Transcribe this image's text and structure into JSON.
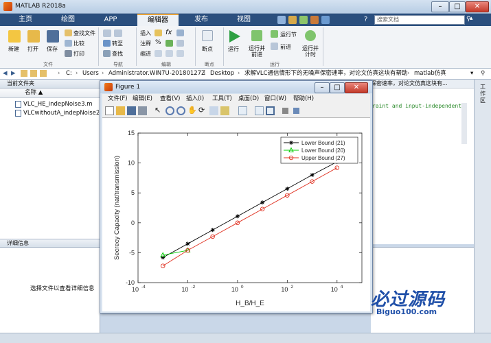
{
  "window": {
    "title": "MATLAB R2018a"
  },
  "tabs": [
    "主页",
    "绘图",
    "APP",
    "编辑器",
    "发布",
    "视图"
  ],
  "search": {
    "placeholder": "搜索文档"
  },
  "ribbon": {
    "new": "新建",
    "open": "打开",
    "save": "保存",
    "find_files": "查找文件",
    "compare": "比较",
    "print": "打印",
    "goto": "转至",
    "find": "查找",
    "insert": "插入",
    "comment": "注释",
    "indent": "缩进",
    "breakpoints": "断点",
    "run": "运行",
    "run_advance": "运行并\n前进",
    "run_section": "运行节",
    "advance": "前进",
    "run_time": "运行并\n计时",
    "groups": {
      "file": "文件",
      "navigate": "导航",
      "edit": "编辑",
      "breakpoints": "断点",
      "run": "运行"
    }
  },
  "address": {
    "parts": [
      "C:",
      "Users",
      "Administrator.WIN7U-20180127Z",
      "Desktop",
      "求解VLC通信情形下的无噪声保密速率，对论文仿真这块有帮助",
      "matlab仿真"
    ]
  },
  "current_folder": {
    "title": "当前文件夹",
    "column": "名称 ▲",
    "files": [
      "VLC_HE_indepNoise3.m",
      "VLCwithoutA_indepNoise2_l"
    ]
  },
  "details": {
    "title": "详细信息",
    "message": "选择文件以查看详细信息"
  },
  "editor": {
    "code_snippet": "raint and input-independent",
    "path_tail": "保密速率，对论文仿真这块有..."
  },
  "right_strip": {
    "label": "工作区"
  },
  "figure": {
    "title": "Figure 1",
    "menus": [
      "文件(F)",
      "编辑(E)",
      "查看(V)",
      "插入(I)",
      "工具(T)",
      "桌面(D)",
      "窗口(W)",
      "帮助(H)"
    ]
  },
  "chart_data": {
    "type": "line",
    "title": "",
    "xlabel": "H_B/H_E",
    "ylabel": "Secrecy Capacity (nat/transmission)",
    "xscale": "log",
    "xlim": [
      0.0001,
      100000
    ],
    "ylim": [
      -10,
      15
    ],
    "xticks": [
      0.0001,
      0.01,
      1,
      100,
      10000
    ],
    "xtick_labels": [
      "10",
      "10",
      "10",
      "10",
      "10"
    ],
    "xtick_exponents": [
      "-4",
      "-2",
      "0",
      "2",
      "4"
    ],
    "yticks": [
      -10,
      -5,
      0,
      5,
      10,
      15
    ],
    "grid": false,
    "legend_position": "top-right",
    "series": [
      {
        "name": "Lower Bound (21)",
        "color": "#000000",
        "marker": "star",
        "x": [
          0.001,
          0.01,
          0.1,
          1,
          10,
          100,
          1000,
          10000
        ],
        "y": [
          -5.8,
          -3.5,
          -1.2,
          1.1,
          3.4,
          5.7,
          8.0,
          10.2
        ]
      },
      {
        "name": "Lower Bound (20)",
        "color": "#00cc00",
        "marker": "triangle",
        "x": [
          0.001,
          0.01
        ],
        "y": [
          -5.4,
          -4.6
        ]
      },
      {
        "name": "Upper Bound (27)",
        "color": "#e03020",
        "marker": "circle",
        "x": [
          0.001,
          0.01,
          0.1,
          1,
          10,
          100,
          1000,
          10000
        ],
        "y": [
          -7.2,
          -4.6,
          -2.3,
          0.0,
          2.3,
          4.6,
          6.9,
          9.2
        ]
      }
    ]
  },
  "watermark": {
    "text": "必过源码",
    "url": "Biguo100.com"
  },
  "colors": {
    "accent": "#e8a33a",
    "tabbar": "#2b4f7e"
  }
}
